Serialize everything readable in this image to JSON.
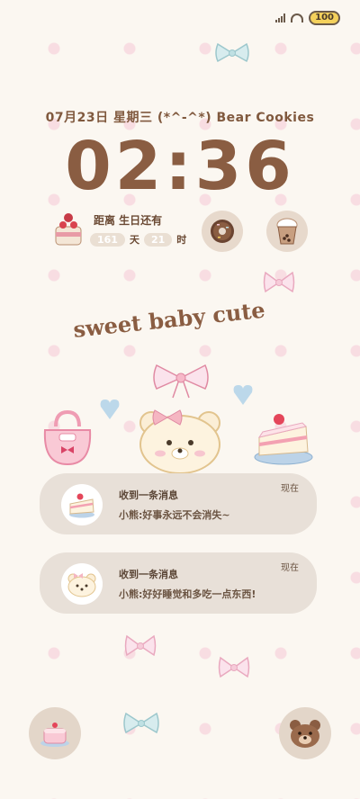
{
  "status": {
    "battery": "100"
  },
  "date_line": "07月23日 星期三 (*^-^*) Bear Cookies",
  "clock": "02:36",
  "birthday": {
    "title": "距离 生日还有",
    "days": "161",
    "days_unit": "天",
    "hours": "21",
    "hours_unit": "时"
  },
  "headline": "sweet baby cute",
  "notifications": [
    {
      "title": "收到一条消息",
      "time": "现在",
      "body": "小熊:好事永远不会消失~"
    },
    {
      "title": "收到一条消息",
      "time": "现在",
      "body": "小熊:好好睡觉和多吃一点东西!"
    }
  ],
  "colors": {
    "background": "#fbf7f1",
    "accent_brown": "#8a5d42",
    "dot_pink": "#f8dde2",
    "card": "#e8e0d8"
  },
  "icons": [
    "cake-icon",
    "donut-icon",
    "bubble-tea-icon",
    "bow-icon",
    "heart-icon",
    "handbag-icon",
    "bear-face-icon",
    "cake-slice-icon",
    "flashlight-cake-icon",
    "camera-bear-icon"
  ]
}
